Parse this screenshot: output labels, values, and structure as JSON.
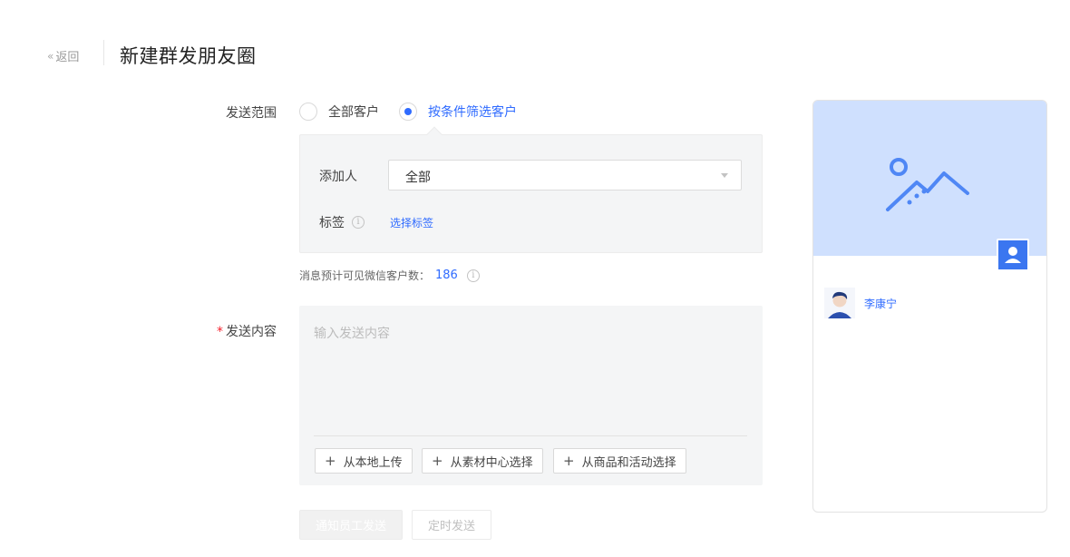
{
  "header": {
    "back_chevron": "«",
    "back_label": "返回",
    "title": "新建群发朋友圈"
  },
  "form": {
    "scope_label": "发送范围",
    "scope_options": [
      "全部客户",
      "按条件筛选客户"
    ],
    "scope_selected_index": 1,
    "filter": {
      "adder_label": "添加人",
      "adder_value": "全部",
      "tag_label": "标签",
      "tag_link": "选择标签"
    },
    "estimate_label": "消息预计可见微信客户数：",
    "estimate_count": "186",
    "content_required_mark": "*",
    "content_label": "发送内容",
    "content_placeholder": "输入发送内容",
    "upload_buttons": [
      "从本地上传",
      "从素材中心选择",
      "从商品和活动选择"
    ],
    "submit_label": "通知员工发送",
    "schedule_label": "定时发送"
  },
  "preview": {
    "user_name": "李康宁"
  },
  "icons": {
    "info": "i",
    "plus": "+"
  },
  "colors": {
    "accent": "#2f6bff",
    "required": "#f5222d",
    "cover": "#cfe0fe",
    "avatar": "#3b76f0"
  }
}
